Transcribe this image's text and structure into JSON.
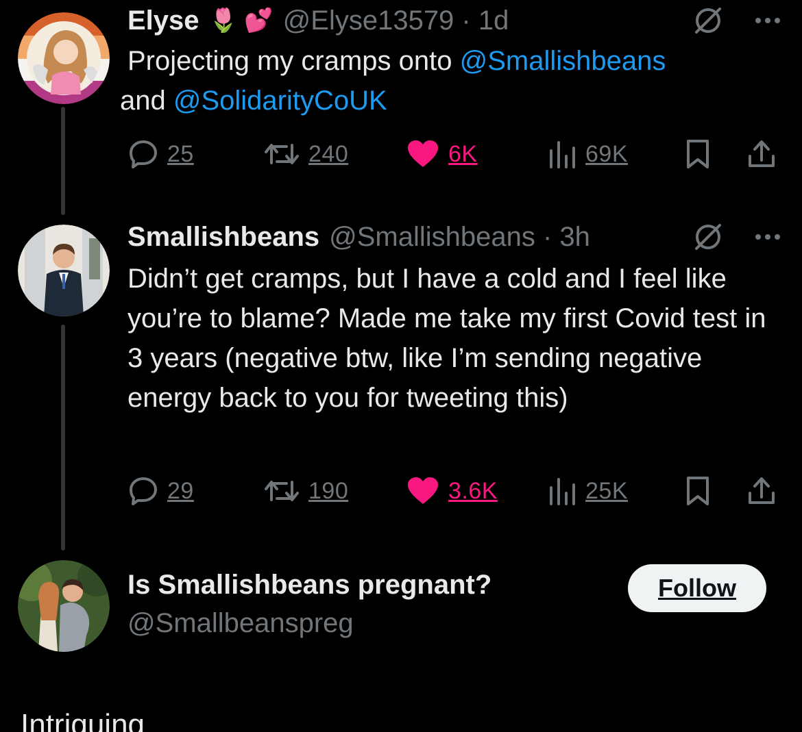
{
  "tweet1": {
    "name": "Elyse",
    "emojis": "🌷 💕",
    "handle_time": "@Elyse13579 · 1d",
    "text_before": "Projecting my cramps onto ",
    "mention1": "@Smallishbeans",
    "text_middle": " and ",
    "mention2": "@SolidarityCoUK",
    "replies": "25",
    "retweets": "240",
    "likes": "6K",
    "views": "69K"
  },
  "tweet2": {
    "name": "Smallishbeans",
    "handle_time": "@Smallishbeans · 3h",
    "text": "Didn’t get cramps, but I have a cold and I feel like you’re to blame? Made me take my first Covid test in 3 years (negative btw, like I’m sending negative energy back to you for tweeting this)",
    "replies": "29",
    "retweets": "190",
    "likes": "3.6K",
    "views": "25K"
  },
  "suggestion": {
    "name": "Is Smallishbeans pregnant?",
    "handle": "@Smallbeanspreg",
    "follow_label": "Follow"
  },
  "bottom_text": "Intriguing",
  "colors": {
    "background": "#000000",
    "text": "#e7e9ea",
    "secondary": "#71767b",
    "link": "#1d9bf0",
    "like": "#f91880"
  }
}
